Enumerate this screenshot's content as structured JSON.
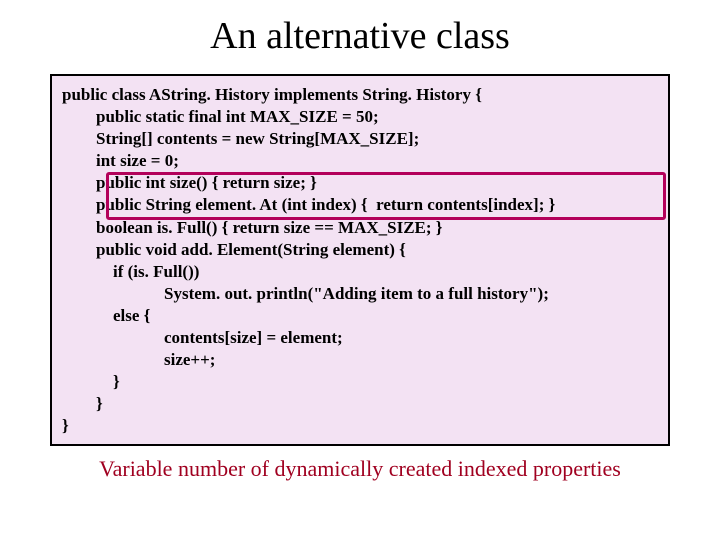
{
  "title": "An alternative class",
  "code": "public class AString. History implements String. History {\n        public static final int MAX_SIZE = 50;\n        String[] contents = new String[MAX_SIZE];\n        int size = 0;\n        public int size() { return size; }\n        public String element. At (int index) {  return contents[index]; }\n        boolean is. Full() { return size == MAX_SIZE; }\n        public void add. Element(String element) {\n            if (is. Full())\n                        System. out. println(\"Adding item to a full history\");\n            else {\n                        contents[size] = element;\n                        size++;\n            }\n        }\n}",
  "caption": "Variable number of dynamically created indexed properties"
}
